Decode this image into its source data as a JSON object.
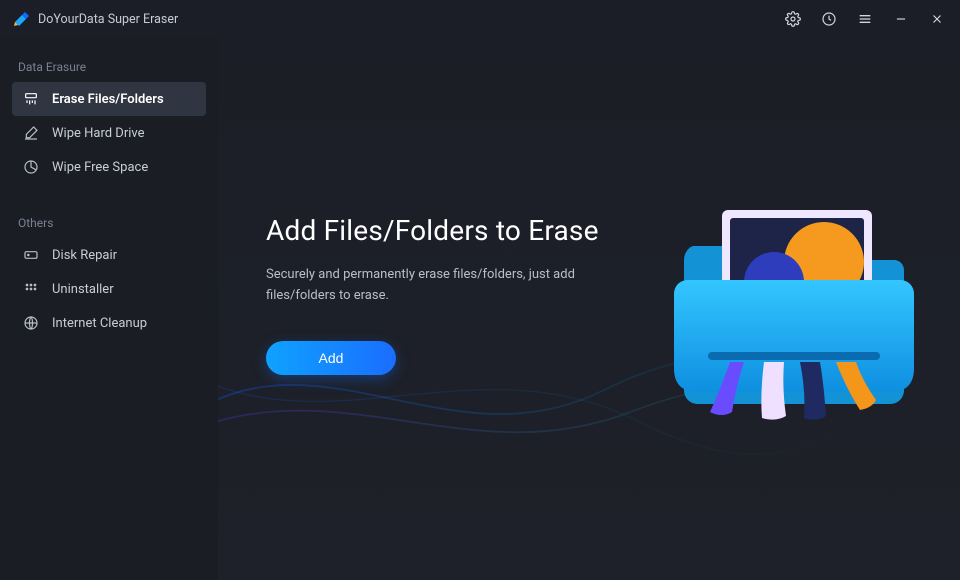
{
  "titlebar": {
    "app_name": "DoYourData Super Eraser"
  },
  "sidebar": {
    "section1_title": "Data Erasure",
    "section2_title": "Others",
    "items": [
      {
        "label": "Erase Files/Folders",
        "icon": "shredder-icon",
        "active": true
      },
      {
        "label": "Wipe Hard Drive",
        "icon": "eraser-icon",
        "active": false
      },
      {
        "label": "Wipe Free Space",
        "icon": "pie-icon",
        "active": false
      }
    ],
    "others": [
      {
        "label": "Disk Repair",
        "icon": "disk-icon"
      },
      {
        "label": "Uninstaller",
        "icon": "grid-icon"
      },
      {
        "label": "Internet Cleanup",
        "icon": "globe-icon"
      }
    ]
  },
  "main": {
    "title": "Add Files/Folders to Erase",
    "description": "Securely and permanently erase files/folders, just add files/folders to erase.",
    "add_label": "Add"
  },
  "colors": {
    "accent_start": "#0fa2ff",
    "accent_end": "#1a6dff",
    "bg": "#1b1e26",
    "sidebar_bg": "#1a1d24"
  }
}
